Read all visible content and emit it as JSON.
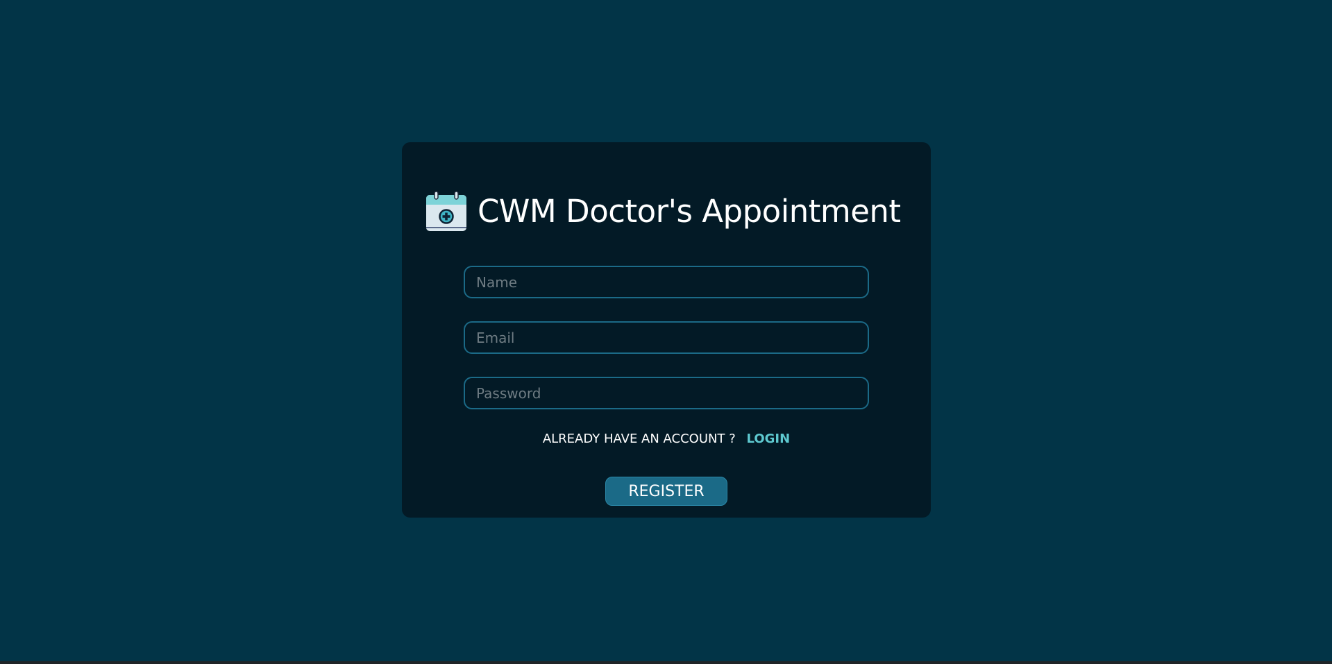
{
  "app": {
    "title": "CWM Doctor's Appointment",
    "logo_icon": "calendar-medical-icon"
  },
  "form": {
    "name_placeholder": "Name",
    "email_placeholder": "Email",
    "password_placeholder": "Password",
    "name_value": "",
    "email_value": "",
    "password_value": ""
  },
  "account": {
    "question": "ALREADY HAVE AN ACCOUNT ?",
    "login_label": "LOGIN"
  },
  "actions": {
    "register_label": "REGISTER"
  },
  "colors": {
    "page_background": "#023447",
    "card_background": "#031a26",
    "accent": "#1b6a87",
    "link": "#5ec9d0",
    "text": "#ffffff"
  }
}
